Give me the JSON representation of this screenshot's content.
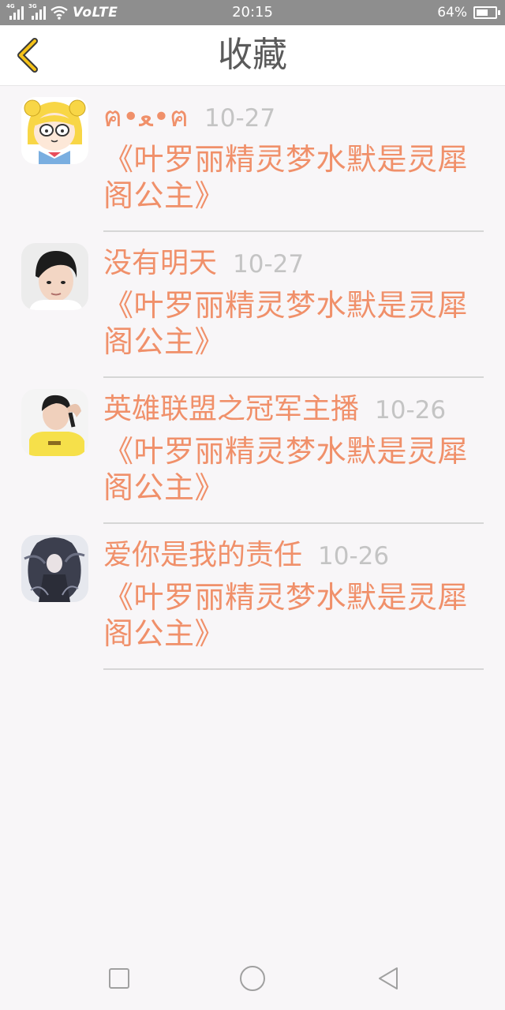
{
  "status_bar": {
    "sim1_tag": "4G",
    "sim2_tag": "3G",
    "volte": "VoLTE",
    "time": "20:15",
    "battery": "64%",
    "battery_level": 0.64
  },
  "header": {
    "title": "收藏",
    "back_icon": "chevron-left-icon"
  },
  "colors": {
    "accent": "#f0906a",
    "time_gray": "#c4c4c4",
    "title_gray": "#5a5a5a",
    "back_arrow": "#f5c218",
    "status_bar": "#8e8e8e",
    "background": "#f8f6f8"
  },
  "favorites": [
    {
      "user": "ฅ•ﻌ•ฅ",
      "time": "10-27",
      "title": "《叶罗丽精灵梦水默是灵犀阁公主》",
      "avatar": "sailor-moon-cartoon-avatar"
    },
    {
      "user": "没有明天",
      "time": "10-27",
      "title": "《叶罗丽精灵梦水默是灵犀阁公主》",
      "avatar": "boy-portrait-avatar"
    },
    {
      "user": "英雄联盟之冠军主播",
      "time": "10-26",
      "title": "《叶罗丽精灵梦水默是灵犀阁公主》",
      "avatar": "boy-hand-on-head-avatar"
    },
    {
      "user": "爱你是我的责任",
      "time": "10-26",
      "title": "《叶罗丽精灵梦水默是灵犀阁公主》",
      "avatar": "anime-dark-girl-avatar"
    }
  ],
  "nav_bar": {
    "recents": "square-icon",
    "home": "circle-icon",
    "back": "triangle-back-icon"
  }
}
